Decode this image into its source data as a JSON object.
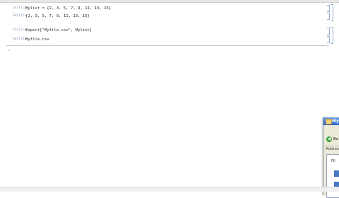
{
  "notebook": {
    "cells": [
      {
        "label": "In[1]:=",
        "text": "Mylist = {2, 3, 5, 7, 9, 11, 13, 15}"
      },
      {
        "label": "Out[1]=",
        "text": "{2, 3, 5, 7, 9, 11, 13, 15}"
      },
      {
        "label": "In[2]:=",
        "text": "Export[\"Myfile.csv\", Mylist]"
      },
      {
        "label": "Out[2]=",
        "text": "Myfile.csv"
      }
    ]
  },
  "explorer": {
    "title": "My",
    "back_label": "Ba",
    "address_label": "Address",
    "file_label": "Fil"
  }
}
